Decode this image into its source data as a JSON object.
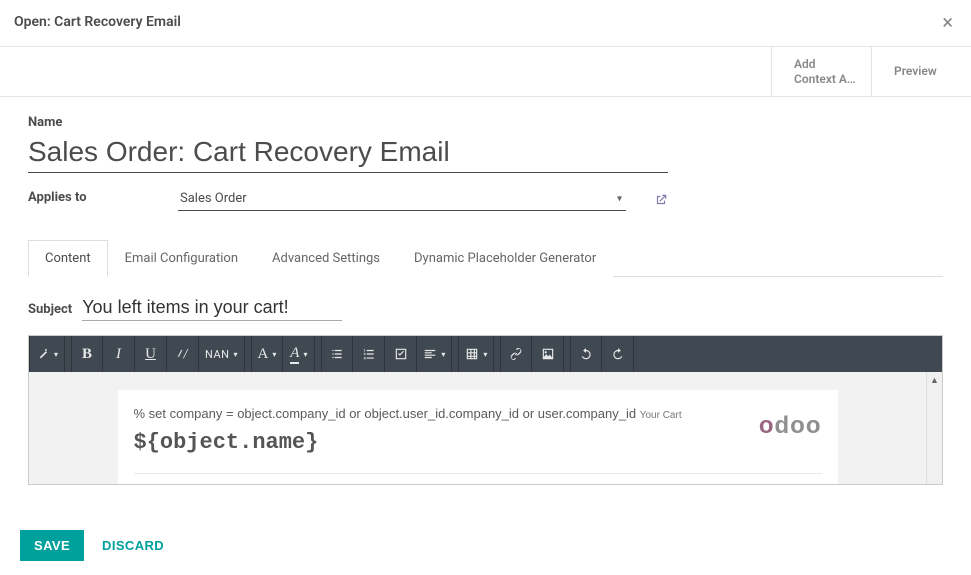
{
  "dialog": {
    "title": "Open: Cart Recovery Email"
  },
  "actions": {
    "add_line1": "Add",
    "add_line2": "Context A…",
    "preview": "Preview"
  },
  "form": {
    "name_label": "Name",
    "name_value": "Sales Order: Cart Recovery Email",
    "applies_label": "Applies to",
    "applies_value": "Sales Order"
  },
  "tabs": [
    {
      "label": "Content",
      "active": true
    },
    {
      "label": "Email Configuration",
      "active": false
    },
    {
      "label": "Advanced Settings",
      "active": false
    },
    {
      "label": "Dynamic Placeholder Generator",
      "active": false
    }
  ],
  "subject": {
    "label": "Subject",
    "value": "You left items in your cart!"
  },
  "toolbar": {
    "font_size_label": "NAN",
    "font_family_glyph": "A",
    "font_color_glyph": "A"
  },
  "editor_body": {
    "set_line": "% set company = object.company_id or object.user_id.company_id or user.company_id",
    "your_cart": "Your Cart",
    "object_name": "${object.name}",
    "logo_text": "odoo"
  },
  "footer": {
    "save": "SAVE",
    "discard": "DISCARD"
  }
}
